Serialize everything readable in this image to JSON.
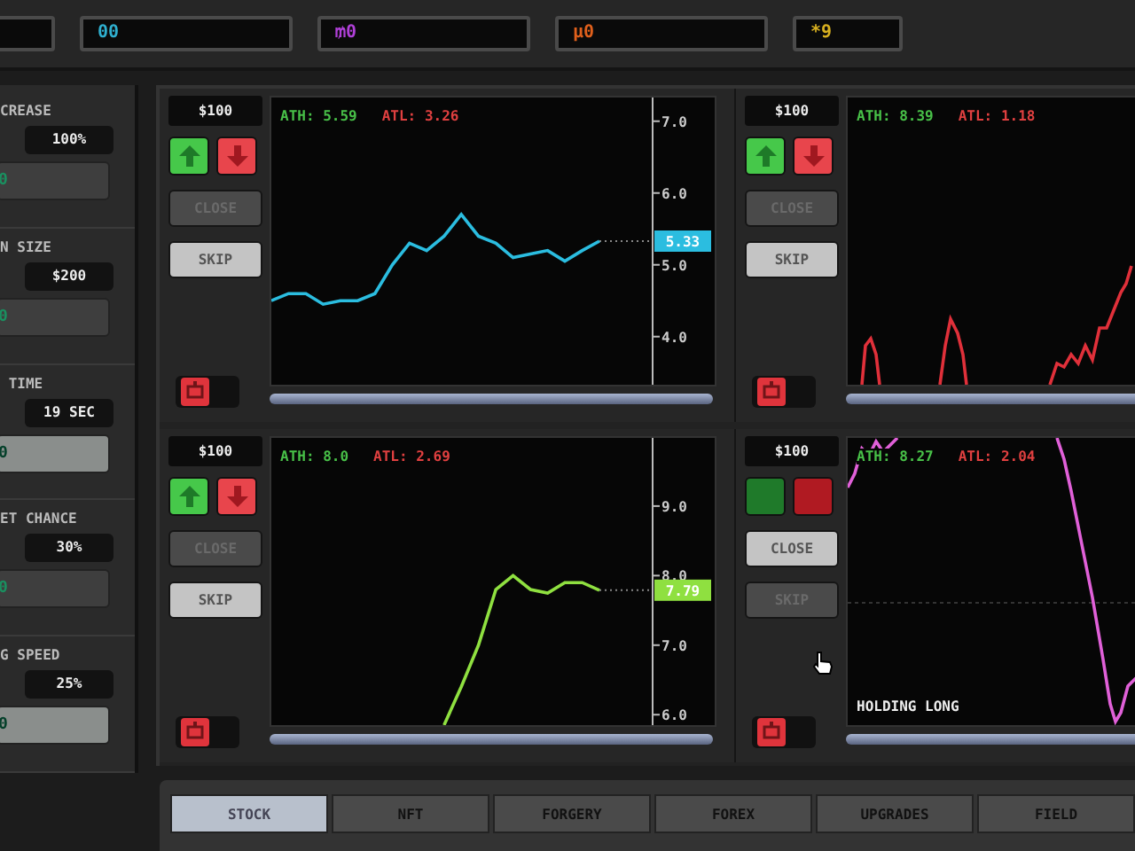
{
  "currencies": [
    {
      "text": "00",
      "color": "#2fb0d0"
    },
    {
      "text": "₥0",
      "color": "#b040d8"
    },
    {
      "text": "μ0",
      "color": "#e0601c"
    },
    {
      "text": "*9",
      "color": "#d8b020"
    }
  ],
  "upgrades": [
    {
      "label": "CREASE",
      "value": "100%",
      "button_text": "0",
      "highlighted": false
    },
    {
      "label": "N SIZE",
      "value": "$200",
      "button_text": "0",
      "highlighted": false
    },
    {
      "label": " TIME",
      "value": "19 SEC",
      "button_text": "0",
      "highlighted": true
    },
    {
      "label": "ET CHANCE",
      "value": "30%",
      "button_text": "0",
      "highlighted": false
    },
    {
      "label": "G SPEED",
      "value": "25%",
      "button_text": "0",
      "highlighted": true
    }
  ],
  "panels": [
    {
      "kind": "axis",
      "price": "$100",
      "trade_enabled": true,
      "close": "CLOSE",
      "close_enabled": false,
      "skip": "SKIP",
      "skip_enabled": true,
      "ath": "ATH: 5.59",
      "atl": "ATL: 3.26",
      "current": "5.33",
      "auto_on": false,
      "chart_data": {
        "type": "line",
        "ylim": [
          3.33,
          7.33
        ],
        "yticks": [
          {
            "value": 4,
            "label": "4.0"
          },
          {
            "value": 5,
            "label": "5.0"
          },
          {
            "value": 6,
            "label": "6.0"
          },
          {
            "value": 7,
            "label": "7.0"
          }
        ],
        "series": [
          {
            "color": "#2bbde0",
            "values": [
              4.5,
              4.6,
              4.6,
              4.45,
              4.5,
              4.5,
              4.6,
              5.0,
              5.3,
              5.2,
              5.4,
              5.7,
              5.4,
              5.3,
              5.1,
              5.15,
              5.2,
              5.05,
              5.2,
              5.33
            ]
          }
        ]
      }
    },
    {
      "kind": "bare",
      "price": "$100",
      "trade_enabled": true,
      "close": "CLOSE",
      "close_enabled": false,
      "skip": "SKIP",
      "skip_enabled": true,
      "ath": "ATH: 8.39",
      "atl": "ATL: 1.18",
      "color": "#e0303a",
      "auto_on": false
    },
    {
      "kind": "axis",
      "price": "$100",
      "trade_enabled": true,
      "close": "CLOSE",
      "close_enabled": false,
      "skip": "SKIP",
      "skip_enabled": true,
      "ath": "ATH: 8.0",
      "atl": "ATL: 2.69",
      "current": "7.79",
      "auto_on": false,
      "chart_data": {
        "type": "line",
        "ylim": [
          5.85,
          9.98
        ],
        "yticks": [
          {
            "value": 6,
            "label": "6.0"
          },
          {
            "value": 7,
            "label": "7.0"
          },
          {
            "value": 8,
            "label": "8.0"
          },
          {
            "value": 9,
            "label": "9.0"
          }
        ],
        "series": [
          {
            "color": "#8fe040",
            "values": [
              null,
              null,
              null,
              null,
              null,
              null,
              null,
              null,
              null,
              null,
              5.85,
              6.4,
              7.0,
              7.8,
              8.0,
              7.8,
              7.75,
              7.9,
              7.9,
              7.79
            ]
          }
        ]
      }
    },
    {
      "kind": "bare",
      "price": "$100",
      "trade_enabled": false,
      "close": "CLOSE",
      "close_enabled": true,
      "skip": "SKIP",
      "skip_enabled": false,
      "ath": "ATH: 8.27",
      "atl": "ATL: 2.04",
      "status": "HOLDING LONG",
      "color": "#e060d8",
      "cursor": true,
      "auto_on": false
    }
  ],
  "tabs": [
    {
      "label": "STOCK",
      "selected": true
    },
    {
      "label": "NFT",
      "selected": false
    },
    {
      "label": "FORGERY",
      "selected": false
    },
    {
      "label": "FOREX",
      "selected": false
    },
    {
      "label": "UPGRADES",
      "selected": false
    },
    {
      "label": "FIELD",
      "selected": false
    }
  ]
}
